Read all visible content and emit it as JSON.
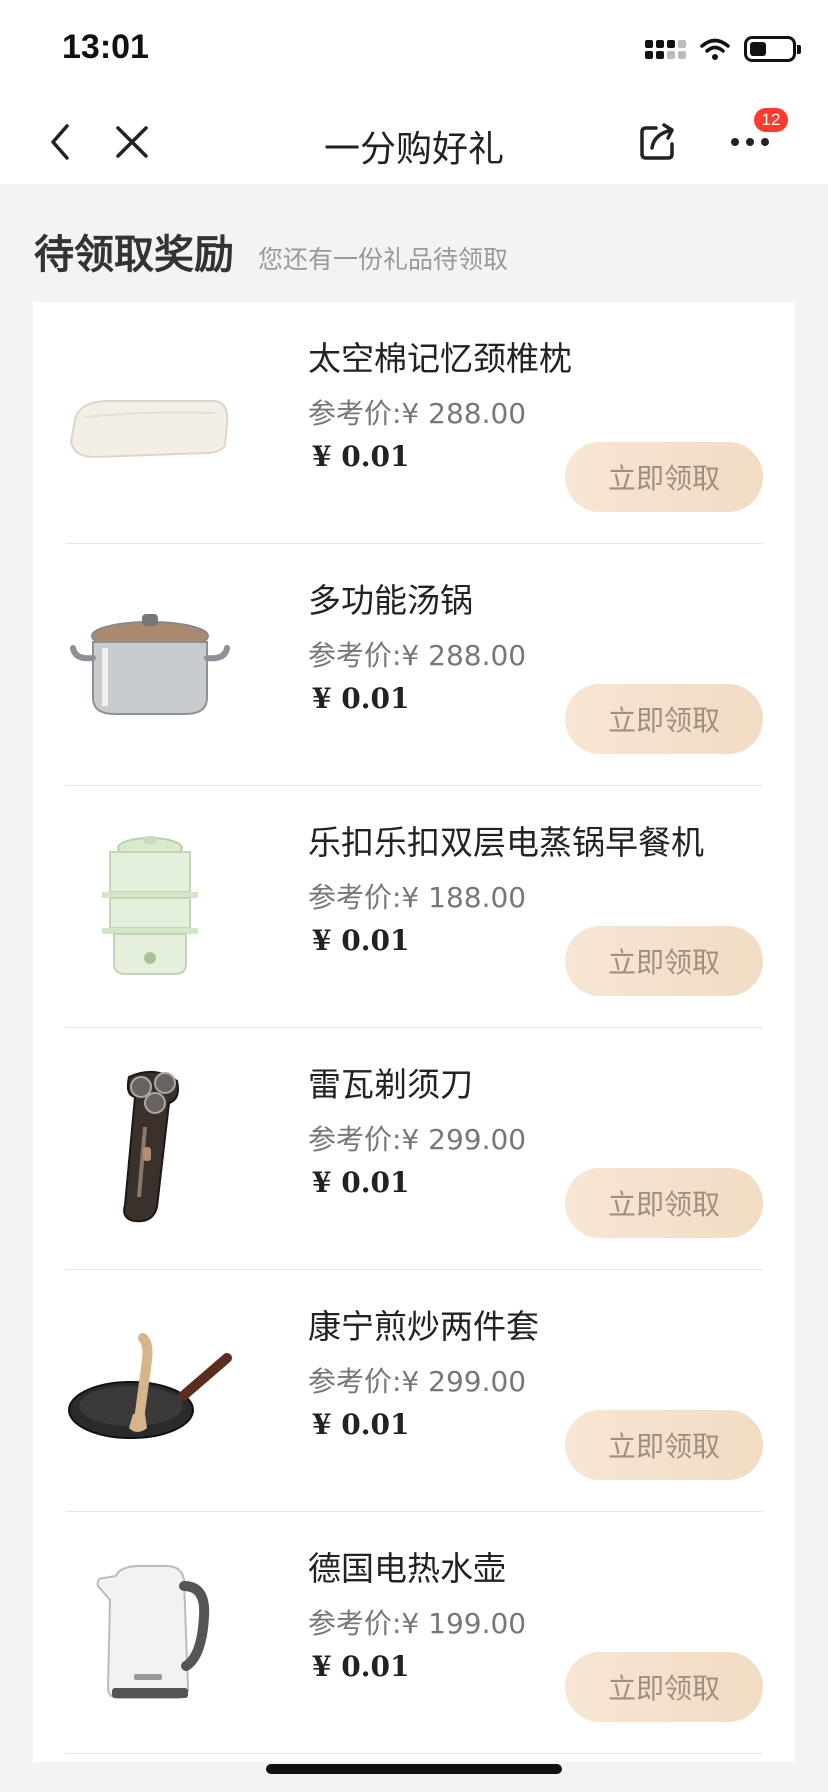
{
  "status_bar": {
    "time": "13:01"
  },
  "nav": {
    "title": "一分购好礼",
    "badge_count": "12"
  },
  "section": {
    "title": "待领取奖励",
    "subtitle": "您还有一份礼品待领取"
  },
  "items": [
    {
      "name": "太空棉记忆颈椎枕",
      "ref_price": "参考价:¥ 288.00",
      "price": "¥ 0.01",
      "button": "立即领取",
      "icon": "pillow-icon"
    },
    {
      "name": "多功能汤锅",
      "ref_price": "参考价:¥ 288.00",
      "price": "¥ 0.01",
      "button": "立即领取",
      "icon": "pot-icon"
    },
    {
      "name": "乐扣乐扣双层电蒸锅早餐机",
      "ref_price": "参考价:¥ 188.00",
      "price": "¥ 0.01",
      "button": "立即领取",
      "icon": "steamer-icon"
    },
    {
      "name": "雷瓦剃须刀",
      "ref_price": "参考价:¥ 299.00",
      "price": "¥ 0.01",
      "button": "立即领取",
      "icon": "shaver-icon"
    },
    {
      "name": "康宁煎炒两件套",
      "ref_price": "参考价:¥ 299.00",
      "price": "¥ 0.01",
      "button": "立即领取",
      "icon": "frying-pan-icon"
    },
    {
      "name": "德国电热水壶",
      "ref_price": "参考价:¥ 199.00",
      "price": "¥ 0.01",
      "button": "立即领取",
      "icon": "kettle-icon"
    }
  ],
  "colors": {
    "page_bg": "#f2f3f5",
    "button_bg": "#f4e2cd",
    "button_text": "#a08f7c",
    "badge": "#ff3b30"
  }
}
